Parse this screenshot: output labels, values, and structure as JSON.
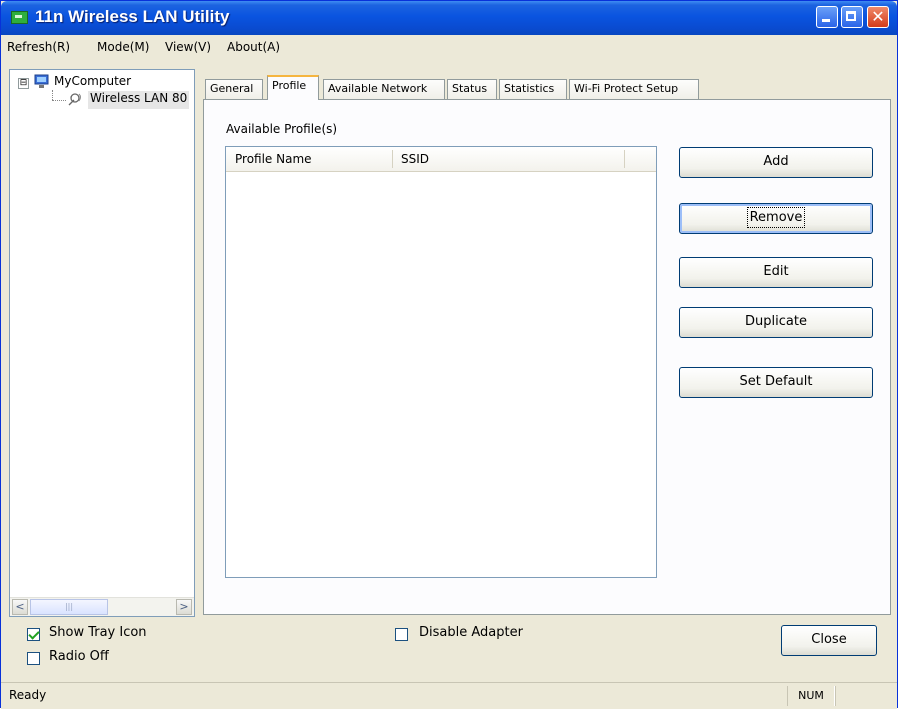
{
  "window": {
    "title": "11n Wireless LAN Utility"
  },
  "menu": [
    {
      "label": "Refresh(R)"
    },
    {
      "label": "Mode(M)"
    },
    {
      "label": "View(V)"
    },
    {
      "label": "About(A)"
    }
  ],
  "tree": {
    "root_label": "MyComputer",
    "child_label": "Wireless LAN 80",
    "expander": "⊟"
  },
  "tabs": [
    {
      "label": "General"
    },
    {
      "label": "Profile"
    },
    {
      "label": "Available Network"
    },
    {
      "label": "Status"
    },
    {
      "label": "Statistics"
    },
    {
      "label": "Wi-Fi Protect Setup"
    }
  ],
  "profile": {
    "group_label": "Available Profile(s)",
    "columns": [
      "Profile Name",
      "SSID"
    ],
    "buttons": {
      "add": "Add",
      "remove": "Remove",
      "edit": "Edit",
      "duplicate": "Duplicate",
      "set_default": "Set Default"
    }
  },
  "options": {
    "show_tray_icon": "Show Tray Icon",
    "radio_off": "Radio Off",
    "disable_adapter": "Disable Adapter"
  },
  "close_label": "Close",
  "status": {
    "text": "Ready",
    "num": "NUM"
  },
  "icons": {
    "app": "wireless-card-icon",
    "computer": "computer-icon",
    "adapter": "wireless-adapter-icon"
  },
  "colors": {
    "titlebar": "#0a54e0",
    "active_tab_accent": "#f5b53f",
    "button_border": "#003c74"
  }
}
